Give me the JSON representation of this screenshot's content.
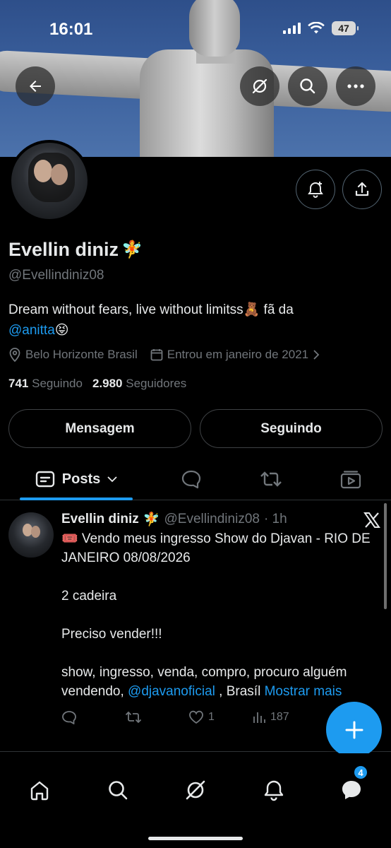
{
  "status_bar": {
    "time": "16:01",
    "battery": "47"
  },
  "header": {
    "back_icon": "arrow-left-icon",
    "grok_icon": "grok-icon",
    "search_icon": "search-icon",
    "more_icon": "more-horizontal-icon"
  },
  "profile": {
    "name": "Evellin diniz",
    "name_emoji": "🧚",
    "handle": "@Evellindiniz08",
    "bio_text": "Dream without fears, live without limitss🧸 fã da",
    "bio_mention": "@anitta",
    "bio_emoji": "😝",
    "location": "Belo Horizonte Brasil",
    "joined": "Entrou em janeiro de 2021",
    "following_count": "741",
    "following_label": "Seguindo",
    "followers_count": "2.980",
    "followers_label": "Seguidores"
  },
  "actions": {
    "message_label": "Mensagem",
    "following_label": "Seguindo"
  },
  "tabs": {
    "posts_label": "Posts"
  },
  "post": {
    "author_name": "Evellin diniz",
    "author_emoji": "🧚",
    "author_handle": "@Evellindiniz08",
    "time": "· 1h",
    "line1": "🎟️ Vendo meus ingresso Show do Djavan - RIO DE JANEIRO 08/08/2026",
    "line2": "2 cadeira",
    "line3": "Preciso vender!!!",
    "line4_text": "show, ingresso, venda, compro, procuro alguém vendendo,",
    "line4_mention": "@djavanoficial",
    "line4_tail": " ,  Brasíl",
    "show_more": "Mostrar mais",
    "likes": "1",
    "views": "187"
  },
  "bottom_nav": {
    "messages_badge": "4"
  },
  "colors": {
    "accent": "#1d9bf0",
    "background": "#000000",
    "muted": "#71767b"
  }
}
